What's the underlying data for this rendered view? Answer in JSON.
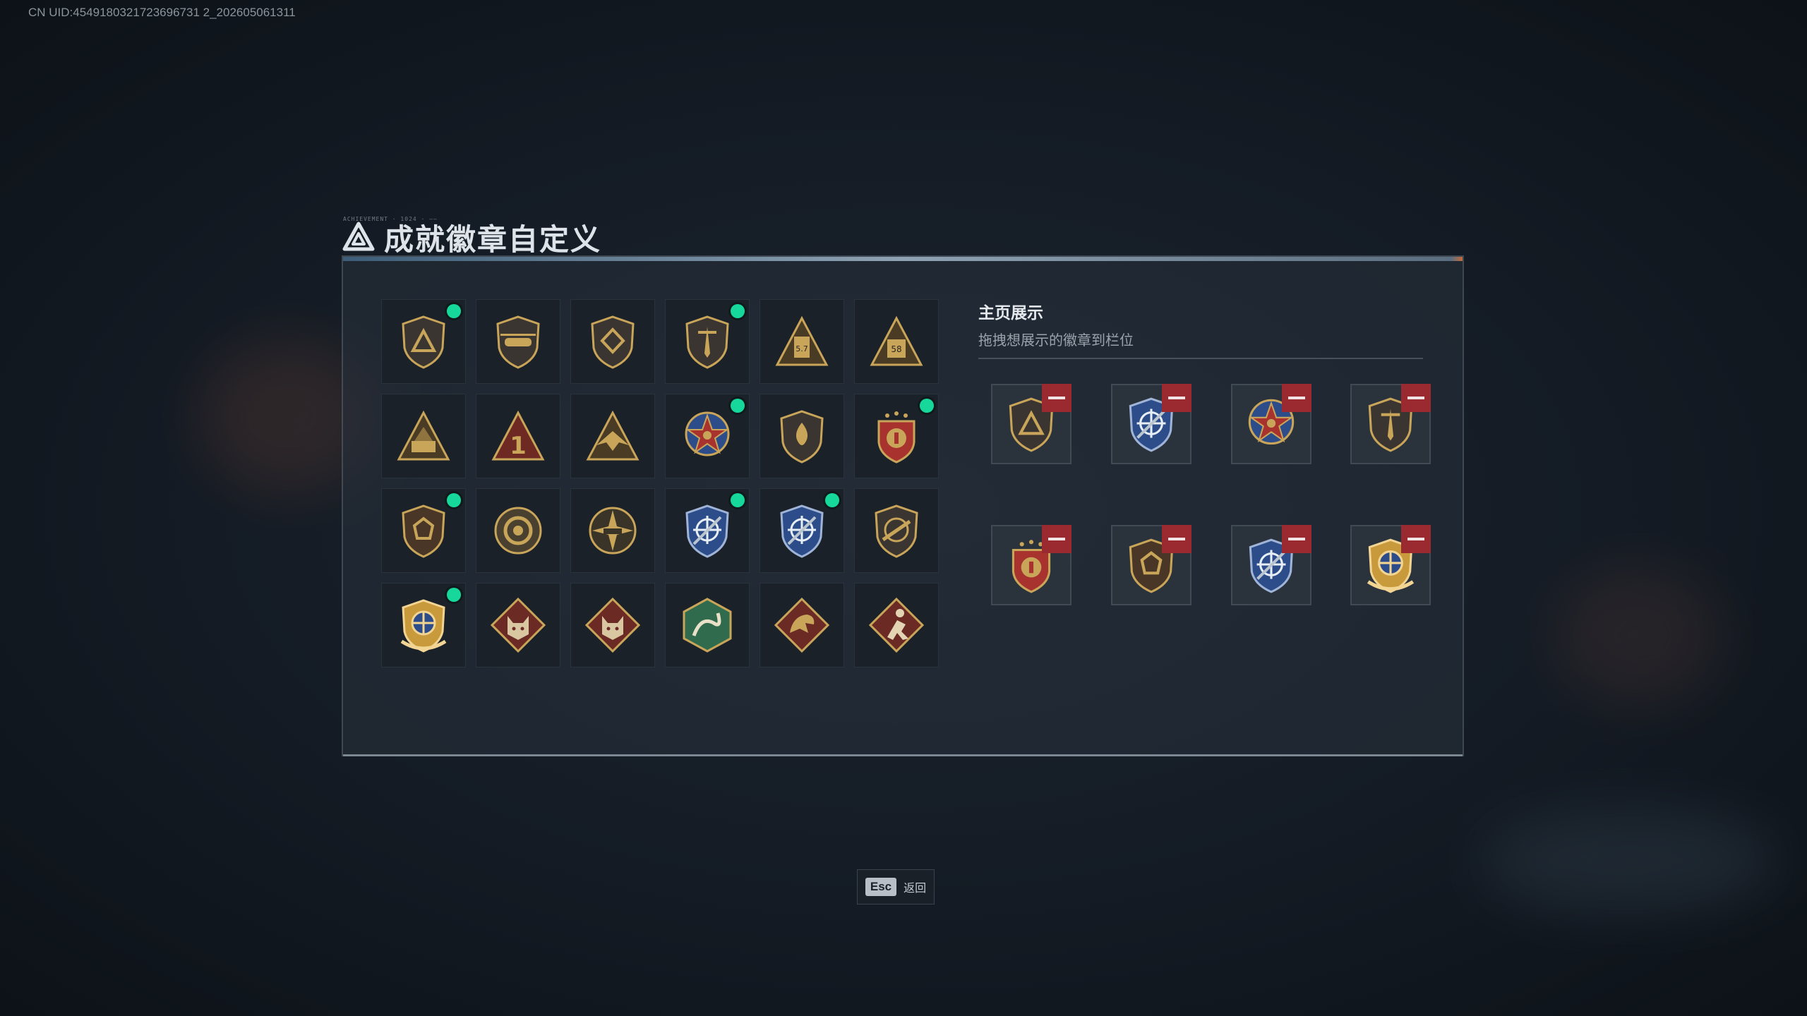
{
  "uid": "CN UID:4549180321723696731 2_202605061311",
  "title": "成就徽章自定义",
  "title_deco": "ACHIEVEMENT · 1024 · ——",
  "colors": {
    "accent_new": "#16d89a",
    "remove": "#9b2a30",
    "gold": "#c9a55a",
    "blue": "#2c4d8a",
    "red": "#a8332e",
    "green": "#2f6b4c"
  },
  "badges": [
    {
      "icon": "triangle-shield-badge-icon",
      "new": true
    },
    {
      "icon": "helicopter-badge-icon",
      "new": false
    },
    {
      "icon": "diamond-shield-badge-icon",
      "new": false
    },
    {
      "icon": "dagger-shield-badge-icon",
      "new": true
    },
    {
      "icon": "ammo-57-triangle-badge-icon",
      "new": false
    },
    {
      "icon": "ammo-58-triangle-badge-icon",
      "new": false
    },
    {
      "icon": "rocket-triangle-badge-icon",
      "new": false
    },
    {
      "icon": "number-one-triangle-badge-icon",
      "new": false
    },
    {
      "icon": "eagle-triangle-badge-icon",
      "new": false
    },
    {
      "icon": "star-medal-badge-icon",
      "new": true
    },
    {
      "icon": "flame-shield-badge-icon",
      "new": false
    },
    {
      "icon": "star-crest-badge-icon",
      "new": true
    },
    {
      "icon": "gem-shield-badge-icon",
      "new": true
    },
    {
      "icon": "wreath-round-badge-icon",
      "new": false
    },
    {
      "icon": "tank-star-badge-icon",
      "new": false
    },
    {
      "icon": "crosshair-blue-shield-badge-icon",
      "new": true
    },
    {
      "icon": "crosshair-blue-shield-badge-icon",
      "new": true
    },
    {
      "icon": "rifle-shield-badge-icon",
      "new": false
    },
    {
      "icon": "gold-crosshair-crest-badge-icon",
      "new": true
    },
    {
      "icon": "wolf-diamond-badge-icon",
      "new": false
    },
    {
      "icon": "wolf-diamond-badge-icon",
      "new": false
    },
    {
      "icon": "serpent-hexagon-badge-icon",
      "new": false
    },
    {
      "icon": "dragon-diamond-badge-icon",
      "new": false
    },
    {
      "icon": "soldier-diamond-badge-icon",
      "new": false
    }
  ],
  "showcase": {
    "title": "主页展示",
    "subtitle": "拖拽想展示的徽章到栏位",
    "slots": [
      "triangle-shield-badge-icon",
      "crosshair-blue-shield-badge-icon",
      "star-medal-badge-icon",
      "dagger-shield-badge-icon",
      "star-crest-badge-icon",
      "gem-shield-badge-icon",
      "crosshair-blue-shield-badge-icon",
      "gold-crosshair-crest-badge-icon"
    ]
  },
  "footer": {
    "esc_key": "Esc",
    "esc_label": "返回"
  }
}
